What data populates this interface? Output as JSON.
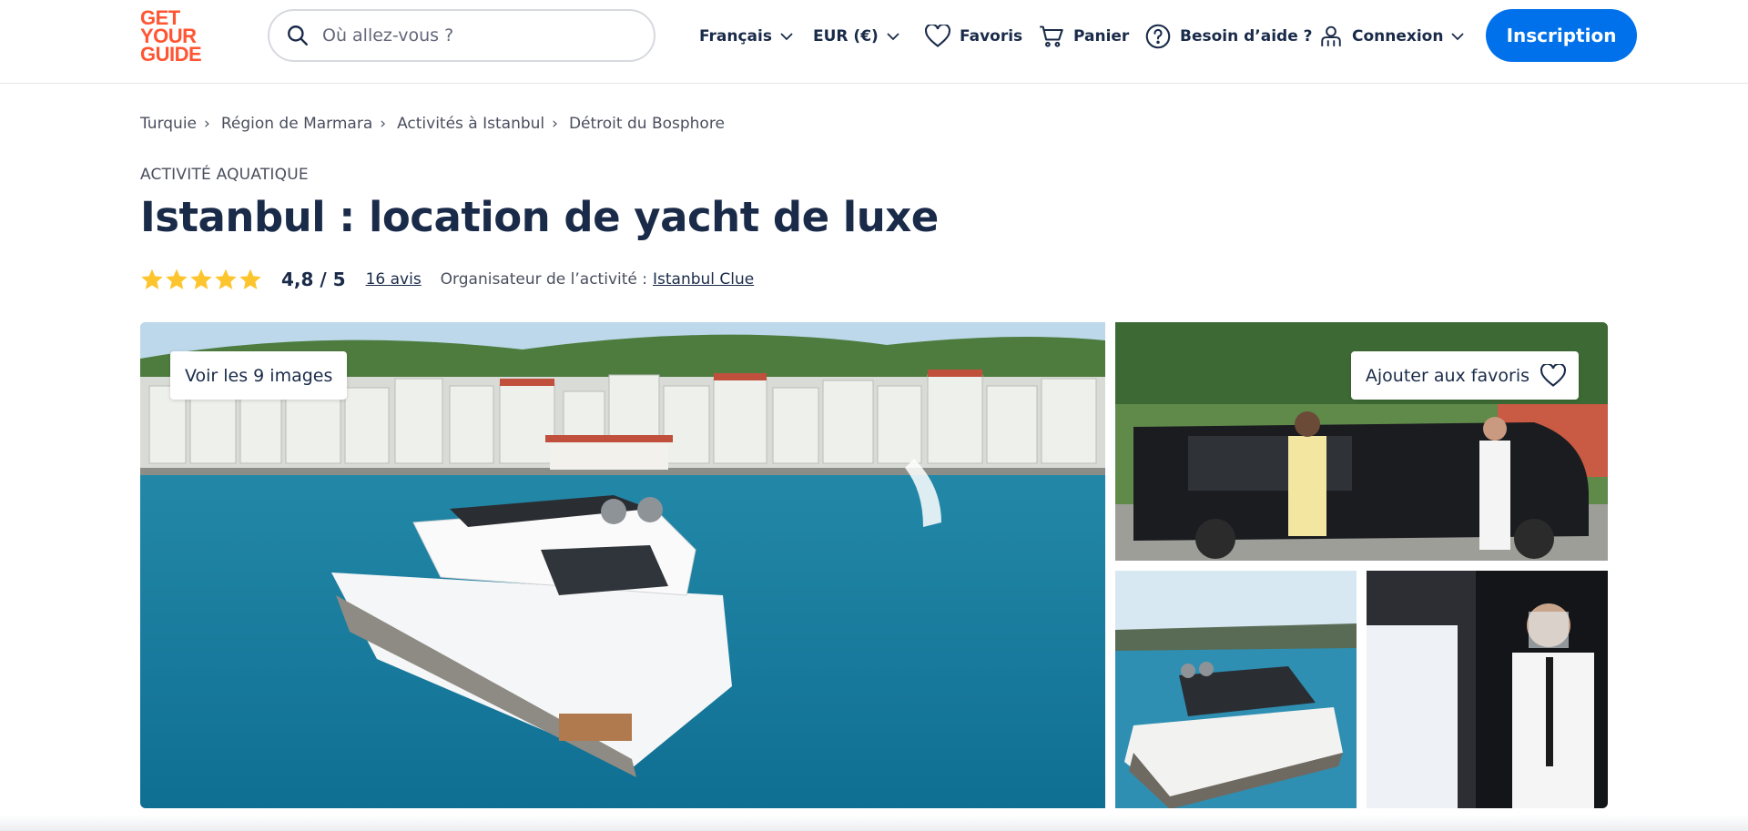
{
  "header": {
    "logo_lines": [
      "GET",
      "YOUR",
      "GUIDE"
    ],
    "search_placeholder": "Où allez-vous ?",
    "language": "Français",
    "currency": "EUR (€)",
    "favorites": "Favoris",
    "cart": "Panier",
    "help": "Besoin d’aide ?",
    "login": "Connexion",
    "signup": "Inscription"
  },
  "breadcrumb": [
    {
      "label": "Turquie",
      "sep": "›"
    },
    {
      "label": "Région de Marmara",
      "sep": "›"
    },
    {
      "label": "Activités à Istanbul",
      "sep": "›"
    },
    {
      "label": "Détroit du Bosphore",
      "sep": ""
    }
  ],
  "activity": {
    "category": "ACTIVITÉ AQUATIQUE",
    "title": "Istanbul : location de yacht de luxe",
    "rating": "4,8 / 5",
    "stars": 5,
    "reviews": "16 avis",
    "organizer_label": "Organisateur de l’activité :",
    "organizer_name": "Istanbul Clue"
  },
  "gallery": {
    "view_images": "Voir les 9 images",
    "add_favorite": "Ajouter aux favoris"
  },
  "colors": {
    "brand": "#ff5533",
    "primary": "#0071eb",
    "text": "#1a2b49",
    "star": "#fdc52d"
  }
}
